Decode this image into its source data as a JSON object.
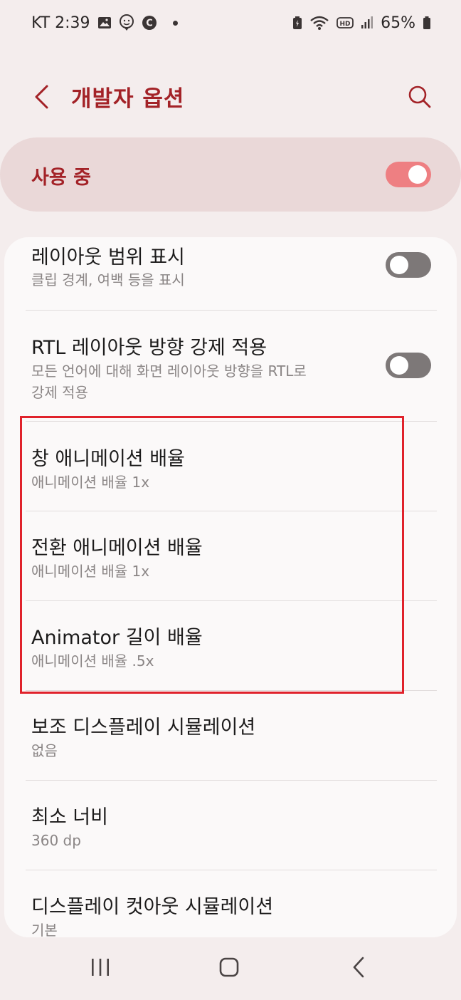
{
  "status_bar": {
    "carrier_time": "KT 2:39",
    "battery_percent": "65%",
    "left_icons": [
      "gallery-icon",
      "face-icon",
      "c-badge-icon",
      "dot-icon"
    ],
    "right_icons": [
      "battery-saver-icon",
      "wifi-icon",
      "hd-icon",
      "signal-icon",
      "battery-icon"
    ]
  },
  "app_bar": {
    "title": "개발자 옵션"
  },
  "master_switch": {
    "label": "사용 중",
    "state": "on"
  },
  "items": [
    {
      "title": "레이아웃 범위 표시",
      "subtitle": "클립 경계, 여백 등을 표시",
      "toggle": "off"
    },
    {
      "title": "RTL 레이아웃 방향 강제 적용",
      "subtitle_line1": "모든 언어에 대해 화면 레이아웃 방향을 RTL로",
      "subtitle_line2": "강제 적용",
      "toggle": "off"
    },
    {
      "title": "창 애니메이션 배율",
      "subtitle": "애니메이션 배율 1x"
    },
    {
      "title": "전환 애니메이션 배율",
      "subtitle": "애니메이션 배율 1x"
    },
    {
      "title": "Animator 길이 배율",
      "subtitle": "애니메이션 배율 .5x"
    },
    {
      "title": "보조 디스플레이 시뮬레이션",
      "subtitle": "없음"
    },
    {
      "title": "최소 너비",
      "subtitle": "360 dp"
    },
    {
      "title": "디스플레이 컷아웃 시뮬레이션",
      "subtitle": "기본"
    }
  ],
  "colors": {
    "accent": "#a32227",
    "toggle_on": "#ee7f82",
    "toggle_off": "#7d7878",
    "highlight_box": "#e0222b"
  }
}
